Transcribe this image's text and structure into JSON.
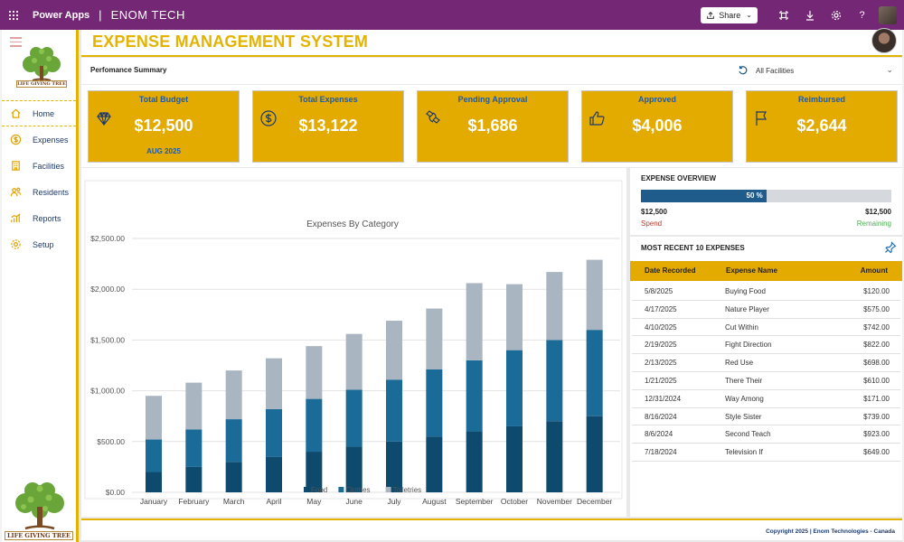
{
  "topbar": {
    "app_name": "Power Apps",
    "separator": "|",
    "company": "ENOM TECH",
    "share_label": "Share",
    "icons": [
      "waffle-icon",
      "share-icon",
      "fit-screen-icon",
      "download-icon",
      "gear-icon",
      "help-icon"
    ]
  },
  "sidebar": {
    "logo_text": "LIFE GIVING TREE",
    "items": [
      {
        "label": "Home",
        "icon": "home-icon"
      },
      {
        "label": "Expenses",
        "icon": "dollar-icon"
      },
      {
        "label": "Facilities",
        "icon": "building-icon"
      },
      {
        "label": "Residents",
        "icon": "people-icon"
      },
      {
        "label": "Reports",
        "icon": "chart-icon"
      },
      {
        "label": "Setup",
        "icon": "gear-icon"
      }
    ]
  },
  "header": {
    "title": "EXPENSE MANAGEMENT SYSTEM"
  },
  "performance": {
    "title": "Perfomance Summary",
    "facility_filter": "All Facilities"
  },
  "kpis": [
    {
      "title": "Total Budget",
      "value": "$12,500",
      "sub": "AUG 2025",
      "icon": "diamond-icon"
    },
    {
      "title": "Total Expenses",
      "value": "$13,122",
      "sub": "",
      "icon": "dollar-circle-icon"
    },
    {
      "title": "Pending Approval",
      "value": "$1,686",
      "sub": "",
      "icon": "exchange-icon"
    },
    {
      "title": "Approved",
      "value": "$4,006",
      "sub": "",
      "icon": "thumbs-up-icon"
    },
    {
      "title": "Reimbursed",
      "value": "$2,644",
      "sub": "",
      "icon": "flag-icon"
    }
  ],
  "overview": {
    "title": "EXPENSE OVERVIEW",
    "percent_label": "50 %",
    "percent": 0.5,
    "spend_value": "$12,500",
    "spend_label": "Spend",
    "remaining_value": "$12,500",
    "remaining_label": "Remaining"
  },
  "recent": {
    "title": "MOST RECENT 10 EXPENSES",
    "columns": [
      "Date Recorded",
      "Expense Name",
      "Amount"
    ],
    "rows": [
      {
        "date": "5/8/2025",
        "name": "Buying Food",
        "amount": "$120.00"
      },
      {
        "date": "4/17/2025",
        "name": "Nature Player",
        "amount": "$575.00"
      },
      {
        "date": "4/10/2025",
        "name": "Cut Within",
        "amount": "$742.00"
      },
      {
        "date": "2/19/2025",
        "name": "Fight Direction",
        "amount": "$822.00"
      },
      {
        "date": "2/13/2025",
        "name": "Red Use",
        "amount": "$698.00"
      },
      {
        "date": "1/21/2025",
        "name": "There Their",
        "amount": "$610.00"
      },
      {
        "date": "12/31/2024",
        "name": "Way Among",
        "amount": "$171.00"
      },
      {
        "date": "8/16/2024",
        "name": "Style Sister",
        "amount": "$739.00"
      },
      {
        "date": "8/6/2024",
        "name": "Second Teach",
        "amount": "$923.00"
      },
      {
        "date": "7/18/2024",
        "name": "Television If",
        "amount": "$649.00"
      }
    ]
  },
  "footer": {
    "text": "Copyright 2025 | Enom Technologies - Canada"
  },
  "chart_data": {
    "type": "bar",
    "stacked": true,
    "title": "Expenses By Category",
    "categories": [
      "January",
      "February",
      "March",
      "April",
      "May",
      "June",
      "July",
      "August",
      "September",
      "October",
      "November",
      "December"
    ],
    "series": [
      {
        "name": "Food",
        "color": "#0d4a6e",
        "values": [
          200,
          250,
          300,
          350,
          400,
          450,
          500,
          550,
          600,
          650,
          700,
          750
        ]
      },
      {
        "name": "Clothes",
        "color": "#1a6b98",
        "values": [
          320,
          370,
          420,
          470,
          520,
          560,
          610,
          660,
          700,
          750,
          800,
          850
        ]
      },
      {
        "name": "Toiletries",
        "color": "#a9b5c1",
        "values": [
          430,
          460,
          480,
          500,
          520,
          550,
          580,
          600,
          760,
          650,
          670,
          690
        ]
      }
    ],
    "y_ticks": [
      "$0.00",
      "$500.00",
      "$1,000.00",
      "$1,500.00",
      "$2,000.00",
      "$2,500.00"
    ],
    "ylim": [
      0,
      2500
    ],
    "grid": true,
    "legend": "bottom"
  }
}
